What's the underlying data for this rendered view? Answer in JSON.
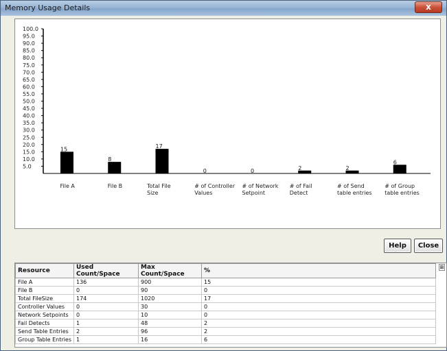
{
  "window": {
    "title": "Memory Usage Details",
    "close_symbol": "x"
  },
  "buttons": {
    "help": "Help",
    "close": "Close"
  },
  "chart_data": {
    "type": "bar",
    "categories": [
      "File A",
      "File B",
      "Total File Size",
      "# of Controller Values",
      "# of Network Setpoint",
      "# of Fail Detect",
      "# of Send table entries",
      "# of Group table entries"
    ],
    "category_lines": [
      [
        "File A"
      ],
      [
        "File B"
      ],
      [
        "Total File",
        "Size"
      ],
      [
        "# of Controller",
        "Values"
      ],
      [
        "# of Network",
        "Setpoint"
      ],
      [
        "# of Fail",
        "Detect"
      ],
      [
        "# of Send",
        "table entries"
      ],
      [
        "# of Group",
        "table entries"
      ]
    ],
    "values": [
      15,
      8,
      17,
      0,
      0,
      2,
      2,
      6
    ],
    "ylim": [
      0,
      100
    ],
    "yticks": [
      "100.0",
      "95.0",
      "90.0",
      "85.0",
      "80.0",
      "75.0",
      "70.0",
      "65.0",
      "60.0",
      "55.0",
      "50.0",
      "45.0",
      "40.0",
      "35.0",
      "30.0",
      "25.0",
      "20.0",
      "15.0",
      "10.0",
      "5.0"
    ],
    "bar_color": "#000000",
    "grid": false
  },
  "table": {
    "headers": [
      "Resource",
      "Used Count/Space",
      "Max Count/Space",
      "%"
    ],
    "rows": [
      [
        "File A",
        "136",
        "900",
        "15"
      ],
      [
        "File B",
        "0",
        "90",
        "0"
      ],
      [
        "Total FileSize",
        "174",
        "1020",
        "17"
      ],
      [
        "Controller Values",
        "0",
        "30",
        "0"
      ],
      [
        "Network Setpoints",
        "0",
        "10",
        "0"
      ],
      [
        "Fail Detects",
        "1",
        "48",
        "2"
      ],
      [
        "Send Table Entries",
        "2",
        "96",
        "2"
      ],
      [
        "Group Table Entries",
        "1",
        "16",
        "6"
      ]
    ]
  }
}
